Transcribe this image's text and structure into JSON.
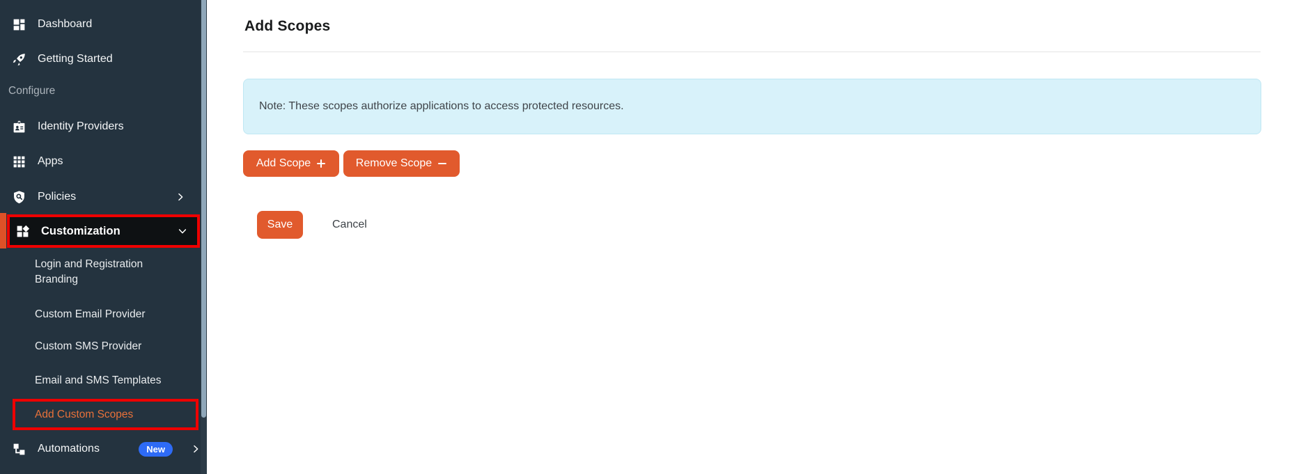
{
  "sidebar": {
    "dashboard": "Dashboard",
    "getting_started": "Getting Started",
    "configure_section": "Configure",
    "identity_providers": "Identity Providers",
    "apps": "Apps",
    "policies": "Policies",
    "customization": "Customization",
    "submenu": {
      "login_branding": "Login and Registration Branding",
      "custom_email": "Custom Email Provider",
      "custom_sms": "Custom SMS Provider",
      "email_sms_templates": "Email and SMS Templates",
      "add_custom_scopes": "Add Custom Scopes"
    },
    "automations": "Automations",
    "automations_badge": "New"
  },
  "main": {
    "title": "Add Scopes",
    "note_text": "Note: These scopes authorize applications to access protected resources.",
    "add_scope_label": "Add Scope",
    "remove_scope_label": "Remove Scope",
    "save_label": "Save",
    "cancel_label": "Cancel"
  },
  "colors": {
    "sidebar_background": "#24333F",
    "active_row_background": "#0E1113",
    "accent_orange": "#E15A2D",
    "active_indicator_orange": "#DE5127",
    "active_link_orange": "#E8713A",
    "annotation_red": "#EE0000",
    "note_background": "#D8F2FA",
    "badge_blue": "#2E6BF6",
    "scrollbar_thumb": "#8FA7B9"
  }
}
